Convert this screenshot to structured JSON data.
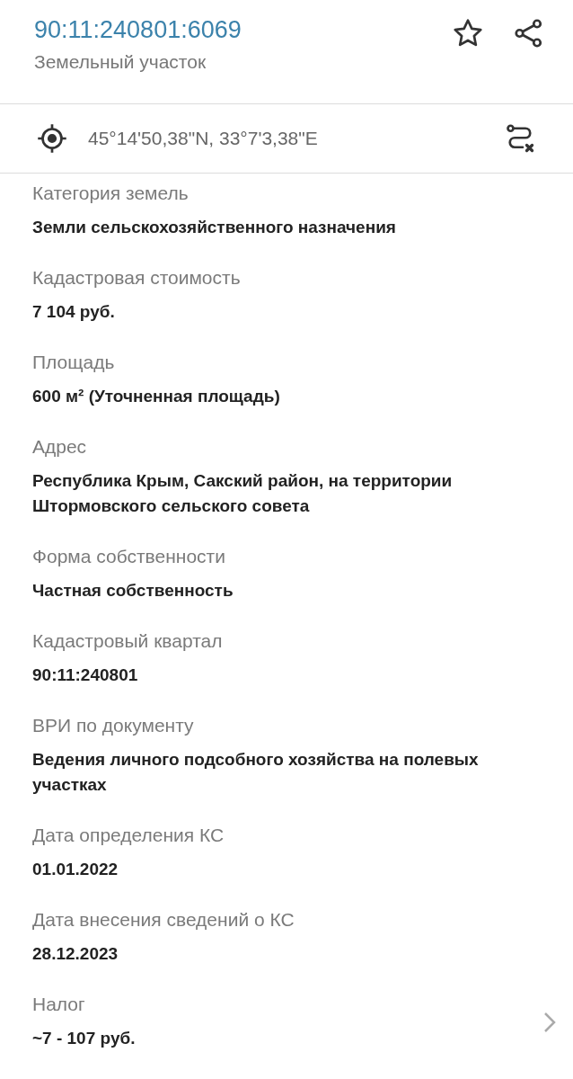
{
  "header": {
    "title": "90:11:240801:6069",
    "subtitle": "Земельный участок",
    "favorite": false
  },
  "coordinates": {
    "text": "45°14'50,38\"N, 33°7'3,38\"E"
  },
  "fields": [
    {
      "kind": "plain",
      "label": "Категория земель",
      "value": "Земли сельскохозяйственного назначения"
    },
    {
      "kind": "plain",
      "label": "Кадастровая стоимость",
      "value": "7 104 руб."
    },
    {
      "kind": "plain",
      "label": "Площадь",
      "value": "600 м² (Уточненная площадь)"
    },
    {
      "kind": "plain",
      "label": "Адрес",
      "value": "Республика Крым, Сакский район, на территории Штормовского сельского совета"
    },
    {
      "kind": "plain",
      "label": "Форма собственности",
      "value": "Частная собственность"
    },
    {
      "kind": "plain",
      "label": "Кадастровый квартал",
      "value": "90:11:240801"
    },
    {
      "kind": "plain",
      "label": "ВРИ по документу",
      "value": "Ведения личного подсобного хозяйства на полевых участках"
    },
    {
      "kind": "plain",
      "label": "Дата определения КС",
      "value": "01.01.2022"
    },
    {
      "kind": "plain",
      "label": "Дата внесения сведений о КС",
      "value": "28.12.2023"
    },
    {
      "kind": "link",
      "label": "Налог",
      "value": "~7 - 107 руб."
    }
  ]
}
